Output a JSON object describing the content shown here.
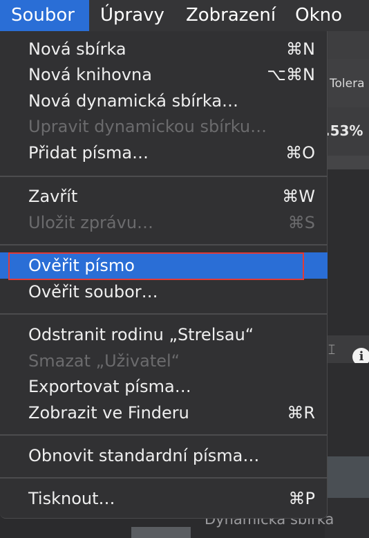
{
  "menubar": {
    "items": [
      "Soubor",
      "Úpravy",
      "Zobrazení",
      "Okno"
    ]
  },
  "background": {
    "toolbar_label": "Tolera",
    "percent": ".53%",
    "bottom_label": "Dynamická sbírka",
    "info_icon": "info-icon",
    "cursor_icon": "text-cursor-icon"
  },
  "menu": {
    "items": [
      {
        "label": "Nová sbírka",
        "shortcut": "⌘N"
      },
      {
        "label": "Nová knihovna",
        "shortcut": "⌥⌘N"
      },
      {
        "label": "Nová dynamická sbírka…",
        "shortcut": ""
      },
      {
        "label": "Upravit dynamickou sbírku…",
        "shortcut": ""
      },
      {
        "label": "Přidat písma…",
        "shortcut": "⌘O"
      },
      {
        "label": "Zavřít",
        "shortcut": "⌘W"
      },
      {
        "label": "Uložit zprávu…",
        "shortcut": "⌘S"
      },
      {
        "label": "Ověřit písmo",
        "shortcut": ""
      },
      {
        "label": "Ověřit soubor…",
        "shortcut": ""
      },
      {
        "label": "Odstranit rodinu „Strelsau“",
        "shortcut": ""
      },
      {
        "label": "Smazat „Uživatel“",
        "shortcut": ""
      },
      {
        "label": "Exportovat písma…",
        "shortcut": ""
      },
      {
        "label": "Zobrazit ve Finderu",
        "shortcut": "⌘R"
      },
      {
        "label": "Obnovit standardní písma…",
        "shortcut": ""
      },
      {
        "label": "Tisknout…",
        "shortcut": "⌘P"
      }
    ]
  },
  "colors": {
    "accent": "#2a6ed6",
    "menu_bg": "#313133",
    "highlight_border": "#e23b36"
  }
}
